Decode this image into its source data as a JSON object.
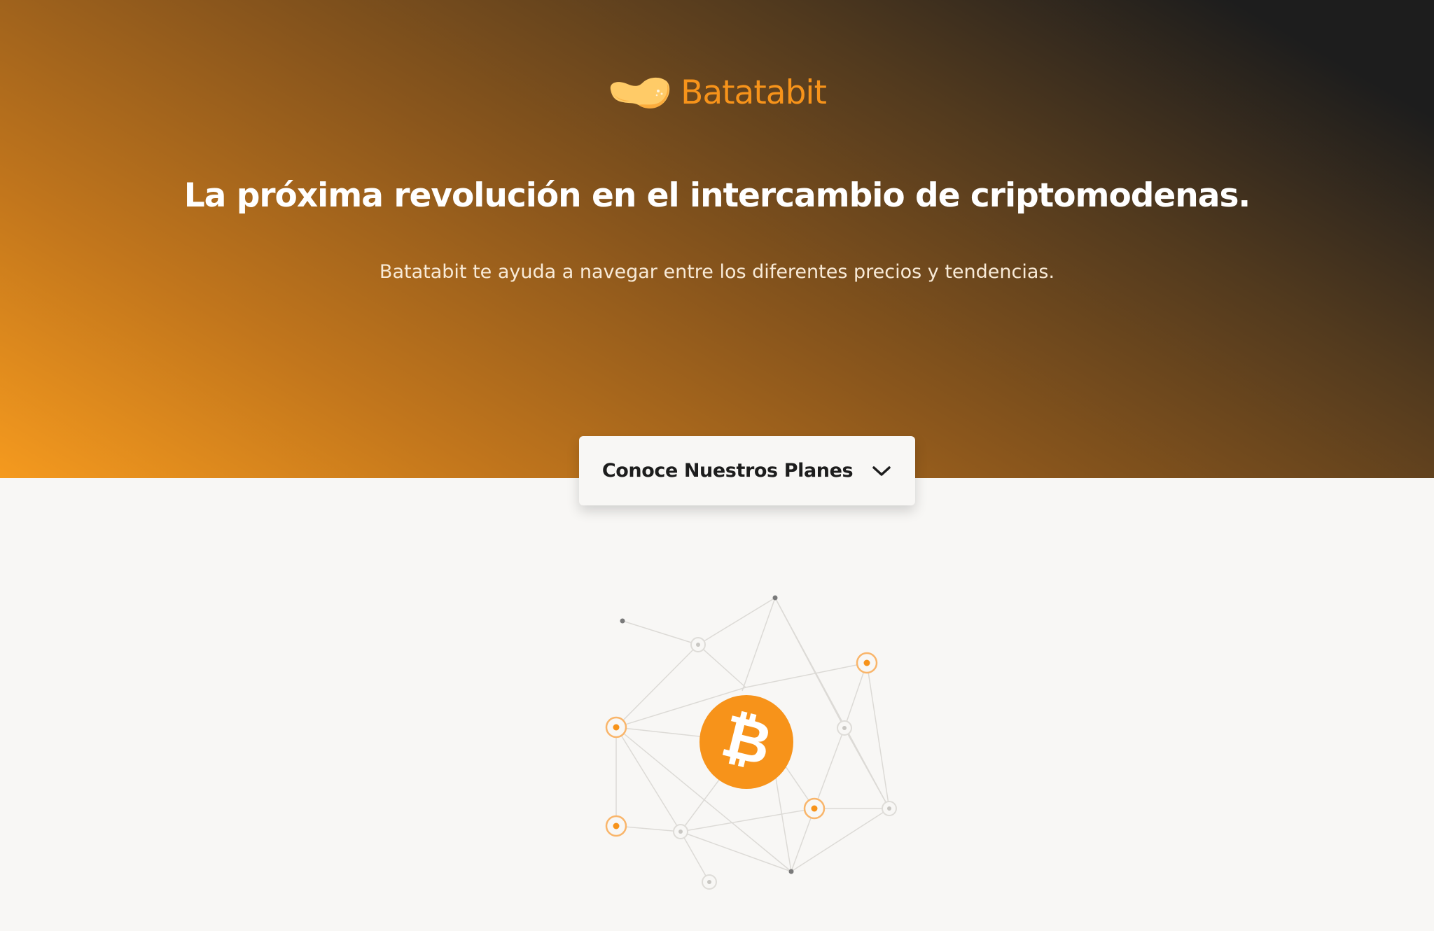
{
  "brand": {
    "name": "Batatabit",
    "logo_icon": "batatabit-potato-logo-icon",
    "color": "#f7931a"
  },
  "hero": {
    "headline": "La próxima revolución en el intercambio de criptomodenas.",
    "subheadline": "Batatabit te ayuda a navegar entre los diferentes precios y tendencias.",
    "gradient_colors": [
      "#1d1d1d",
      "#8a561c",
      "#f59a1e"
    ]
  },
  "plans_button": {
    "label": "Conoce Nuestros Planes",
    "icon": "chevron-down-icon"
  },
  "illustration": {
    "icon": "bitcoin-icon",
    "accent_color": "#f7931a"
  }
}
